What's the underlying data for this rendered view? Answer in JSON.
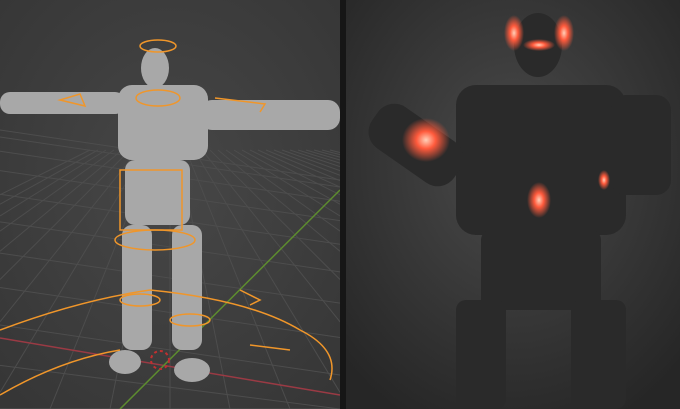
{
  "scene": {
    "left_view": {
      "mode": "viewport-rig",
      "background_color": "#3d3d3d",
      "grid_color": "#4a4a4a",
      "rig_color": "#f0962a",
      "mesh_color": "#a8a8a8",
      "x_axis_color": "#9a3a44",
      "y_axis_color": "#5d8c2f"
    },
    "right_view": {
      "mode": "rendered",
      "background_color": "#3a3a3a",
      "armor_color": "#2a2a2a",
      "glow_color": "#ff5a3c"
    }
  }
}
